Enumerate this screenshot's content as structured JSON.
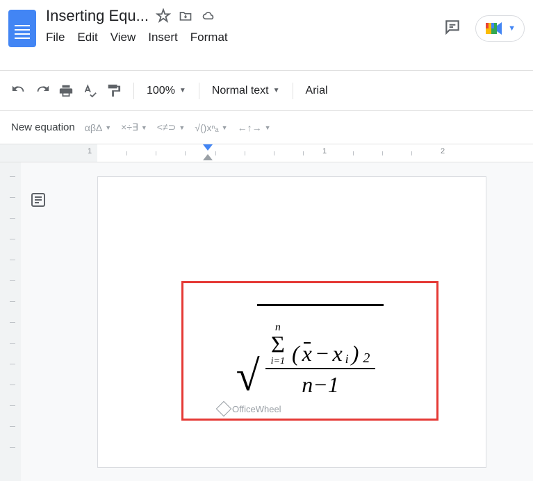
{
  "header": {
    "title": "Inserting Equ...",
    "menu": [
      "File",
      "Edit",
      "View",
      "Insert",
      "Format"
    ]
  },
  "toolbar": {
    "zoom": "100%",
    "style": "Normal text",
    "font": "Arial"
  },
  "equationBar": {
    "newLabel": "New equation",
    "groups": [
      "αβΔ",
      "×÷∃",
      "<≠⊃",
      "√()xⁿₐ",
      "←↑→"
    ]
  },
  "ruler": {
    "numbers": [
      "1",
      "1",
      "2"
    ]
  },
  "equation": {
    "sigmaTop": "n",
    "sigmaBottom": "i=1",
    "xbar": "x",
    "minus1": "−",
    "xi_x": "x",
    "xi_i": "i",
    "exponent": "2",
    "den_n": "n",
    "den_minus": "−",
    "den_one": "1"
  },
  "watermark": "OfficeWheel"
}
